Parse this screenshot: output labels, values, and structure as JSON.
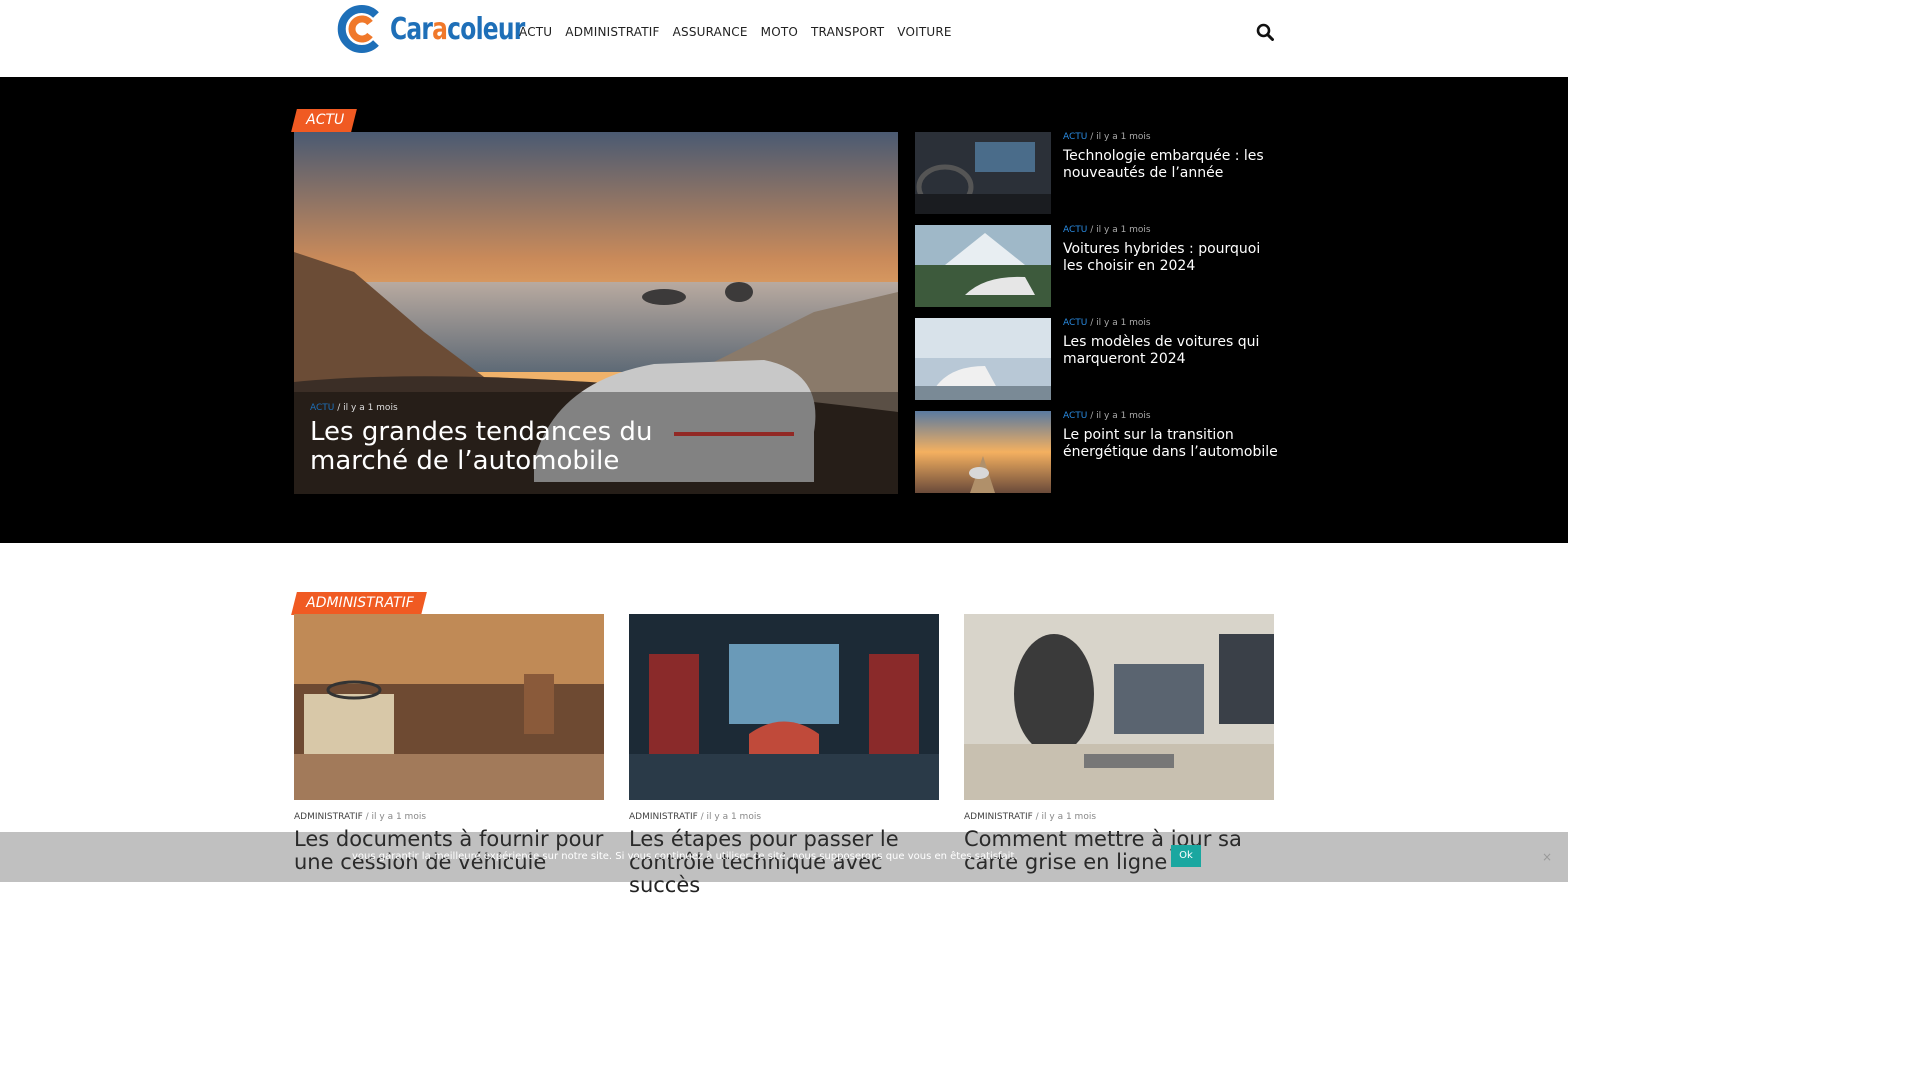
{
  "header": {
    "logo": {
      "part1": "Car",
      "part2": "a",
      "part3": "coleur"
    },
    "nav": [
      "ACTU",
      "ADMINISTRATIF",
      "ASSURANCE",
      "MOTO",
      "TRANSPORT",
      "VOITURE"
    ],
    "search_icon": "search-icon"
  },
  "hero": {
    "tag": "ACTU",
    "featured": {
      "category": "ACTU",
      "time": "il y a 1 mois",
      "title": "Les grandes tendances du marché de l’automobile"
    },
    "side": [
      {
        "category": "ACTU",
        "time": "il y a 1 mois",
        "title": "Technologie embarquée : les nouveautés de l’année"
      },
      {
        "category": "ACTU",
        "time": "il y a 1 mois",
        "title": "Voitures hybrides : pourquoi les choisir en 2024"
      },
      {
        "category": "ACTU",
        "time": "il y a 1 mois",
        "title": "Les modèles de voitures qui marqueront 2024"
      },
      {
        "category": "ACTU",
        "time": "il y a 1 mois",
        "title": "Le point sur la transition énergétique dans l’automobile"
      }
    ]
  },
  "admin": {
    "tag": "ADMINISTRATIF",
    "cards": [
      {
        "category": "ADMINISTRATIF",
        "time": "il y a 1 mois",
        "title": "Les documents à fournir pour une cession de véhicule"
      },
      {
        "category": "ADMINISTRATIF",
        "time": "il y a 1 mois",
        "title": "Les étapes pour passer le contrôle technique avec succès"
      },
      {
        "category": "ADMINISTRATIF",
        "time": "il y a 1 mois",
        "title": "Comment mettre à jour sa carte grise en ligne"
      }
    ]
  },
  "cookie": {
    "text": "vous garantir la meilleure expérience sur notre site. Si vous continuez à utiliser ce site, nous supposerons que vous en êtes satisfait.",
    "ok": "Ok",
    "close": "×"
  },
  "colors": {
    "accent": "#f05a22",
    "brand_blue": "#1e6fb8",
    "brand_orange": "#f0782a"
  }
}
